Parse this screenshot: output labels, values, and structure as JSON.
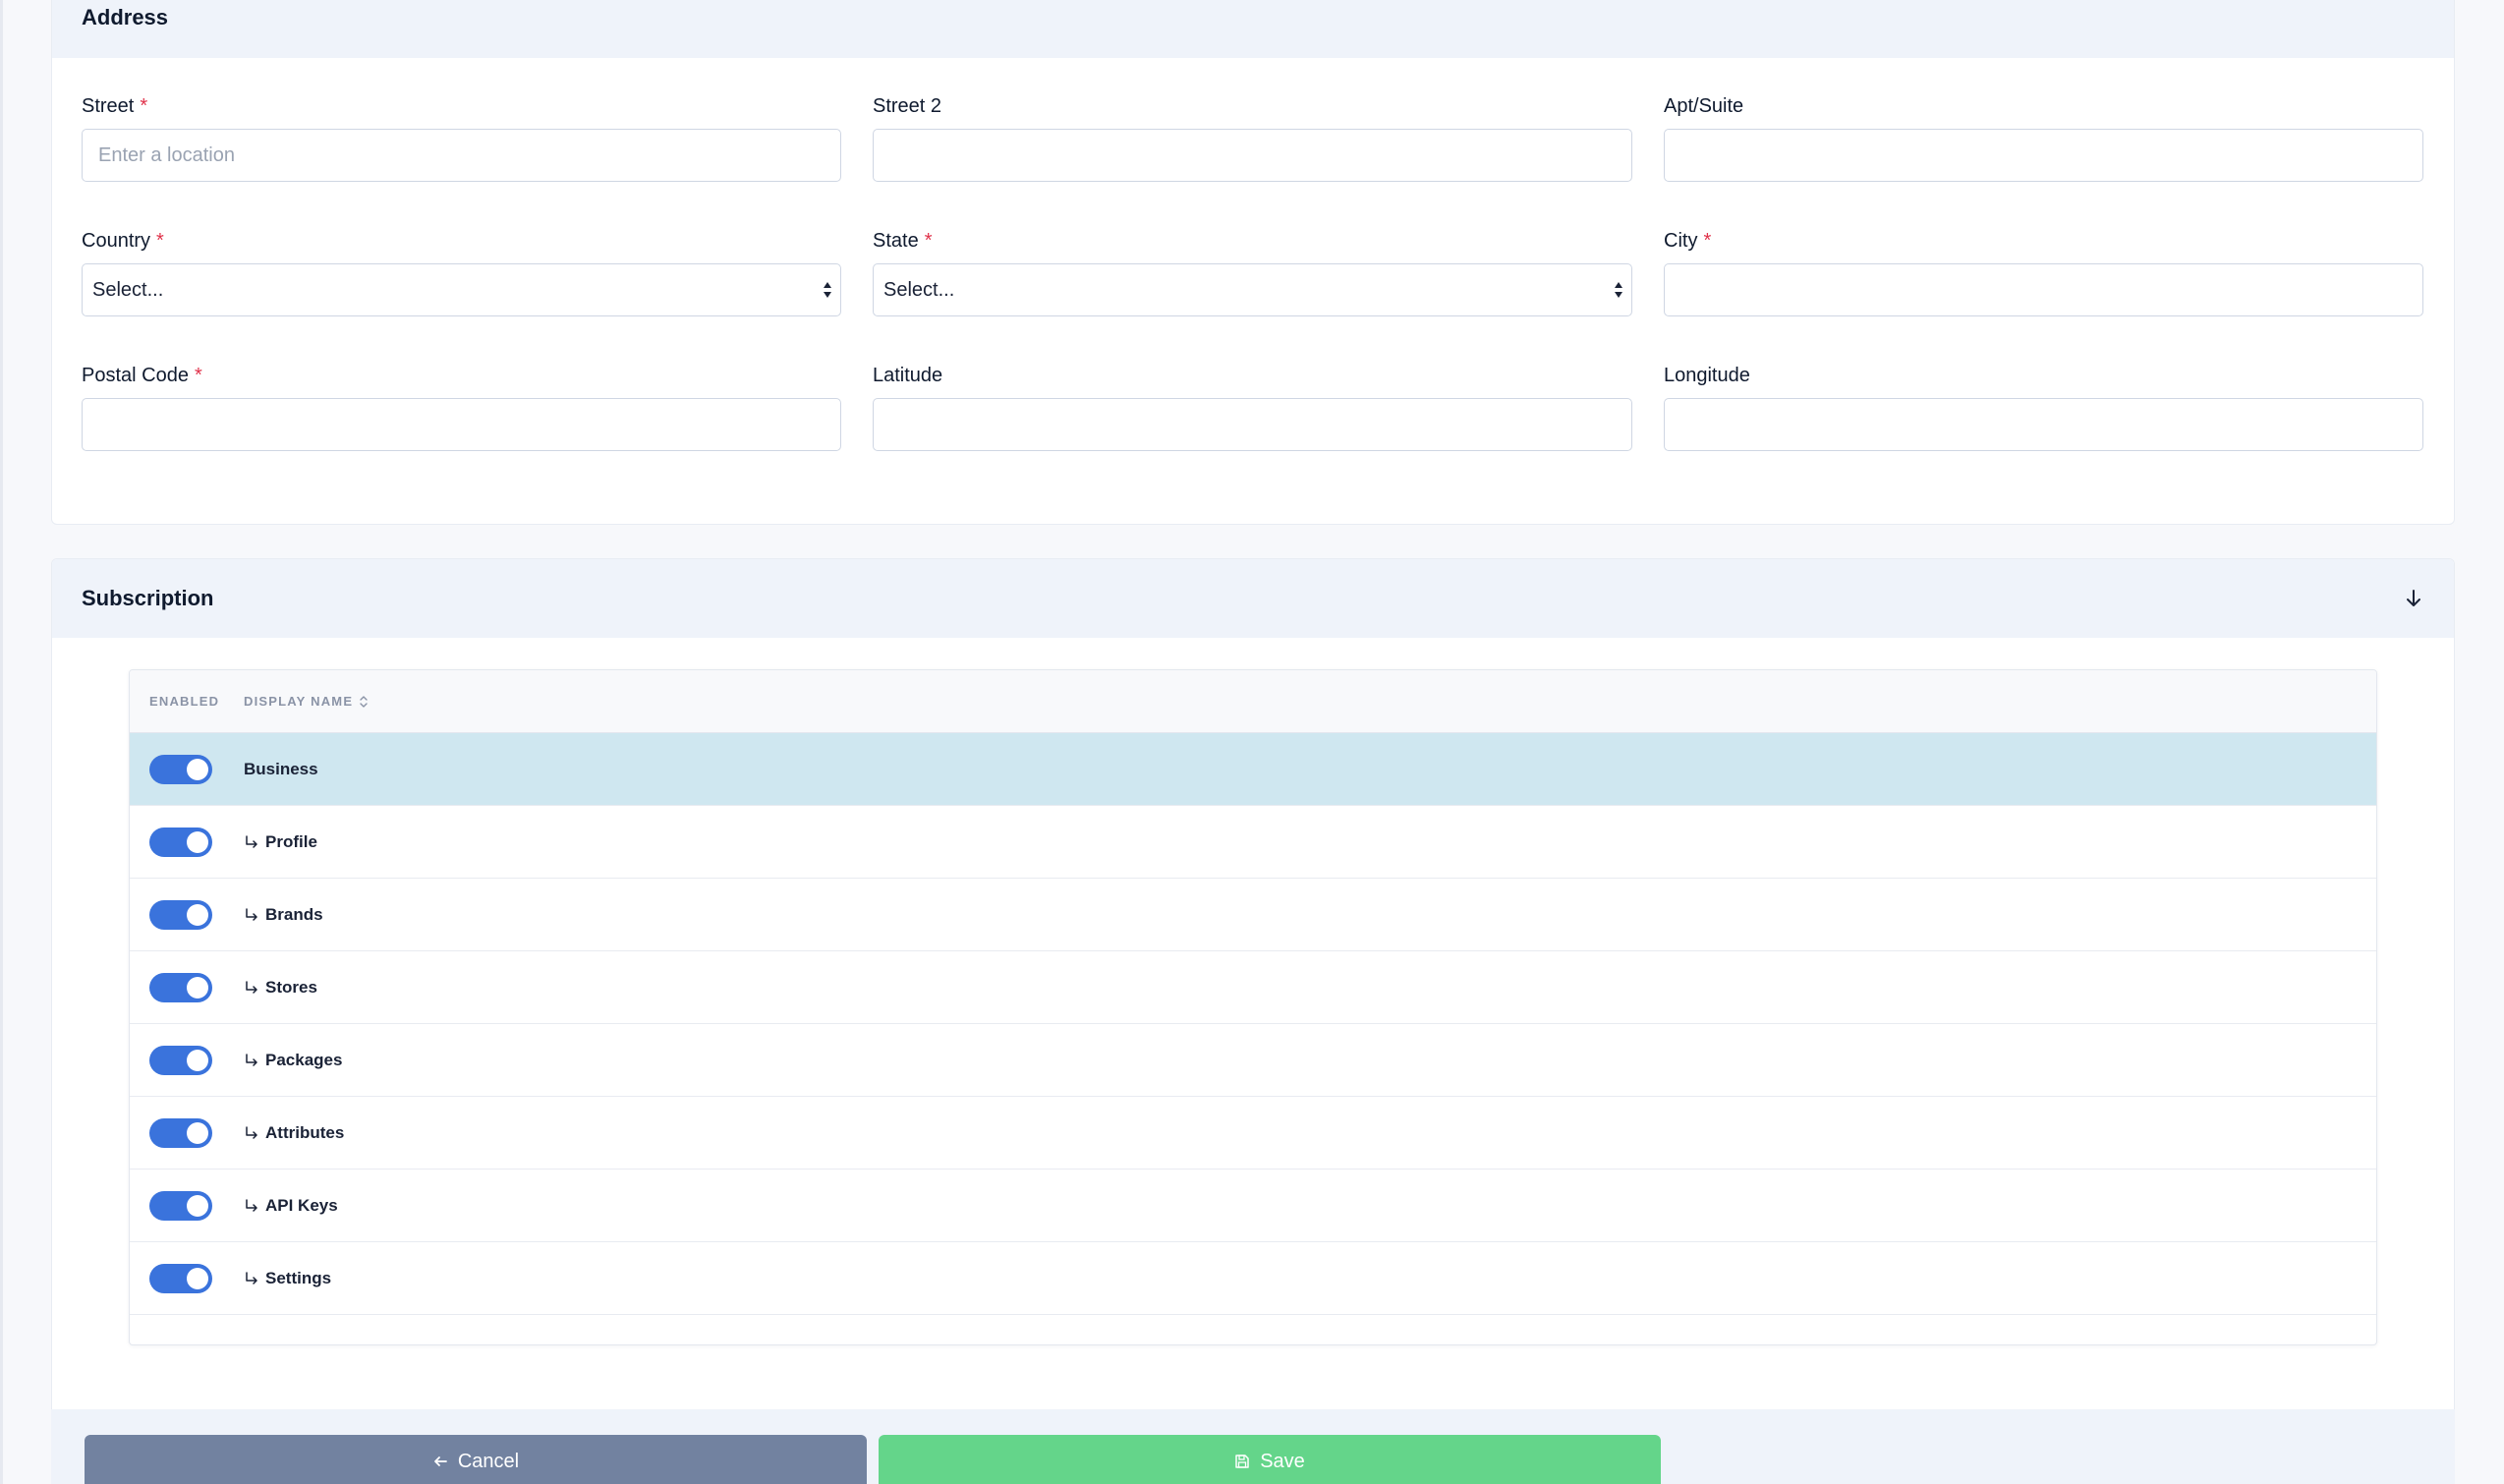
{
  "address": {
    "title": "Address",
    "fields": {
      "street": {
        "label": "Street",
        "required": "*",
        "placeholder": "Enter a location",
        "value": ""
      },
      "street2": {
        "label": "Street 2",
        "value": ""
      },
      "apt": {
        "label": "Apt/Suite",
        "value": ""
      },
      "country": {
        "label": "Country",
        "required": "*",
        "selected": "Select..."
      },
      "state": {
        "label": "State",
        "required": "*",
        "selected": "Select..."
      },
      "city": {
        "label": "City",
        "required": "*",
        "value": ""
      },
      "postal": {
        "label": "Postal Code",
        "required": "*",
        "value": ""
      },
      "latitude": {
        "label": "Latitude",
        "value": ""
      },
      "longitude": {
        "label": "Longitude",
        "value": ""
      }
    }
  },
  "subscription": {
    "title": "Subscription",
    "collapse_icon": "arrow-down-icon",
    "table": {
      "col_enabled": "Enabled",
      "col_name": "Display Name",
      "rows": [
        {
          "name": "Business",
          "enabled": true,
          "child": false
        },
        {
          "name": "Profile",
          "enabled": true,
          "child": true
        },
        {
          "name": "Brands",
          "enabled": true,
          "child": true
        },
        {
          "name": "Stores",
          "enabled": true,
          "child": true
        },
        {
          "name": "Packages",
          "enabled": true,
          "child": true
        },
        {
          "name": "Attributes",
          "enabled": true,
          "child": true
        },
        {
          "name": "API Keys",
          "enabled": true,
          "child": true
        },
        {
          "name": "Settings",
          "enabled": true,
          "child": true
        }
      ]
    }
  },
  "actions": {
    "cancel_label": "Cancel",
    "save_label": "Save"
  },
  "colors": {
    "toggle_on": "#3a73dc",
    "highlight_row": "#cfe7f0",
    "cancel": "#7282a0",
    "save": "#64d58a",
    "required": "#e0324a"
  }
}
